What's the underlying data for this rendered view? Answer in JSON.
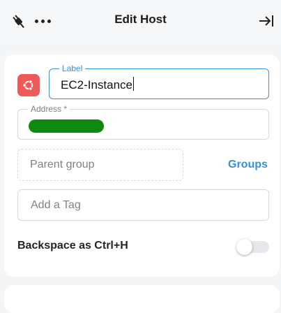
{
  "header": {
    "title": "Edit Host",
    "left_icon": "plug-icon",
    "menu_icon": "more-icon",
    "right_icon": "collapse-panel-icon"
  },
  "host": {
    "os_icon": "ubuntu-icon",
    "os_color": "#ee5a5a",
    "label": {
      "caption": "Label",
      "value": "EC2-Instance"
    },
    "address": {
      "caption": "Address *"
    },
    "parent_group": {
      "placeholder": "Parent group"
    },
    "groups_link": "Groups",
    "tag": {
      "placeholder": "Add a Tag"
    },
    "backspace_setting": {
      "label": "Backspace as Ctrl+H",
      "enabled": false
    }
  },
  "colors": {
    "accent": "#3a8fd8",
    "redaction": "#0b8a0b"
  }
}
